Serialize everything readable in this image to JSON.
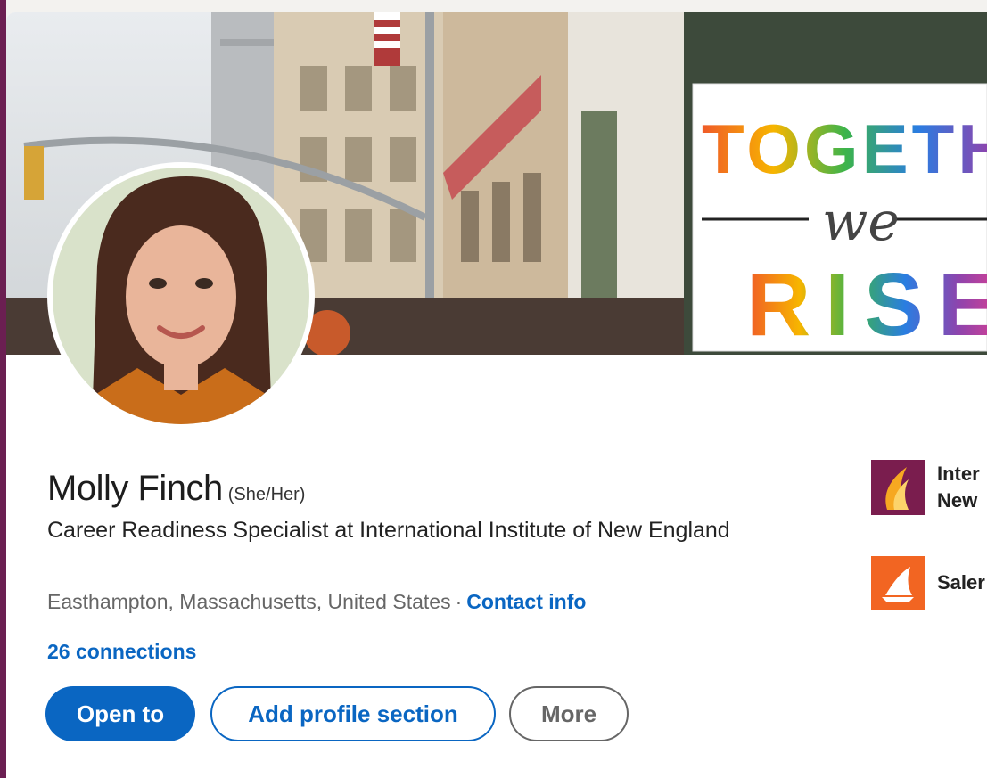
{
  "profile": {
    "name": "Molly Finch",
    "pronouns": "(She/Her)",
    "headline": "Career Readiness Specialist at International Institute of New England",
    "location": "Easthampton, Massachusetts, United States",
    "separator": "·",
    "contact_info_label": "Contact info",
    "connections_label": "26 connections"
  },
  "cover_banner": {
    "sign_line1": "TOGETHE",
    "sign_line2": "we",
    "sign_line3": "RISE"
  },
  "actions": {
    "open_to": "Open to",
    "add_profile_section": "Add profile section",
    "more": "More"
  },
  "experience_orgs": [
    {
      "label_line1": "Inter",
      "label_line2": "New",
      "logo": "institute-flame-icon",
      "logo_color": "#7a1d4e"
    },
    {
      "label_line1": "Saler",
      "logo": "ship-icon",
      "logo_color": "#f26522"
    }
  ],
  "colors": {
    "primary": "#0a66c2",
    "sidebar_accent": "#6b1f52",
    "card_bg": "#ffffff",
    "page_bg": "#f3f2ef"
  }
}
